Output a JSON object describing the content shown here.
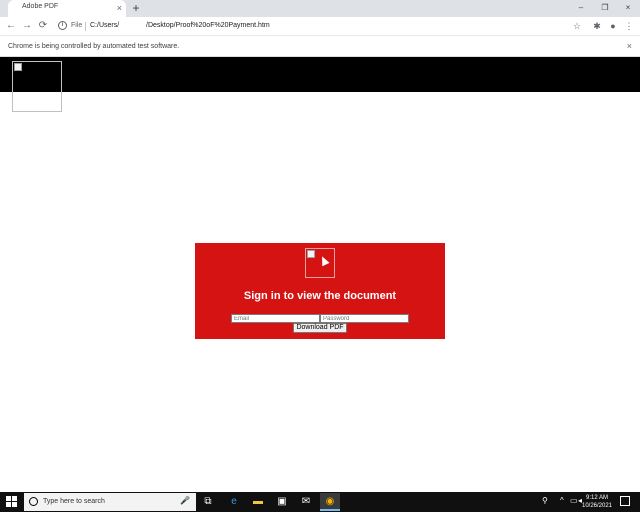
{
  "browser": {
    "tab_title": "Adobe PDF",
    "tab_close": "×",
    "new_tab": "+",
    "window_minimize": "–",
    "window_restore": "❐",
    "window_close": "×",
    "back": "←",
    "forward": "→",
    "reload": "⟳",
    "scheme_label": "File",
    "url_part1": "C:/Users/",
    "url_part2": "/Desktop/Proof%20oF%20Payment.htm",
    "infobar_text": "Chrome is being controlled by automated test software.",
    "infobar_close": "×"
  },
  "page": {
    "title": "Sign in to view the document",
    "email_placeholder": "Email",
    "password_placeholder": "Password",
    "download_label": "Download PDF",
    "panel_color": "#d61313",
    "header_color": "#000000"
  },
  "taskbar": {
    "search_placeholder": "Type here to search",
    "time": "9:12 AM",
    "date": "10/26/2021"
  },
  "icons": [
    "info-icon",
    "star-icon",
    "extensions-icon",
    "profile-icon",
    "menu-icon",
    "mic-icon",
    "task-view-icon",
    "edge-icon",
    "file-explorer-icon",
    "store-icon",
    "mail-icon",
    "chrome-icon",
    "people-icon",
    "chevron-up-icon",
    "network-icon",
    "volume-icon",
    "notification-icon"
  ]
}
